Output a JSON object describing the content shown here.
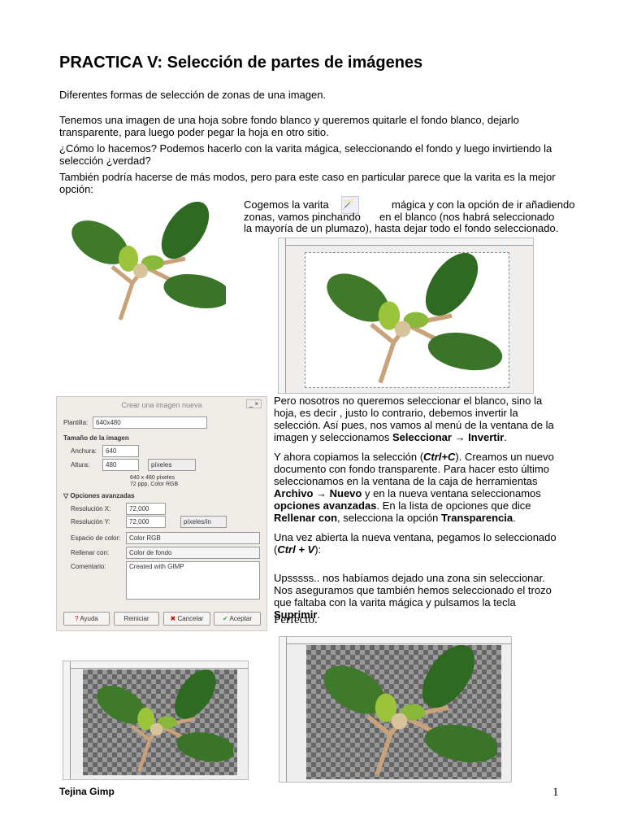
{
  "title": "PRACTICA V: Selección de partes de imágenes",
  "paragraphs": [
    "Diferentes formas de selección de zonas de una imagen.",
    "Tenemos una imagen de una hoja sobre fondo blanco y queremos quitarle el fondo blanco, dejarlo transparente, para luego poder pegar la hoja en otro sitio.",
    "¿Cómo lo hacemos? Podemos hacerlo con la varita mágica, seleccionando el fondo y luego invirtiendo la selección ¿verdad?",
    "También podría hacerse de más modos, pero para este caso en particular parece que la varita es la mejor opción:"
  ],
  "right": {
    "p1a": "Cogemos la varita",
    "p1b": "mágica y con la opción de ir añadiendo",
    "p1c": "zonas, vamos pinchando",
    "p1d": "en el blanco (nos habrá seleccionado",
    "p1e": "la mayoría de un plumazo), hasta dejar todo el fondo seleccionado.",
    "p2": "Pero nosotros no queremos seleccionar el blanco, sino la hoja, es decir , justo lo contrario, debemos invertir la selección. Así pues, nos vamos al menú de la ventana de la imagen y seleccionamos ",
    "p2b": "Seleccionar → Invertir",
    "p3a": "Y ahora copiamos la selección (",
    "p3b": "Ctrl+C",
    "p3c": "). Creamos un nuevo documento con fondo transparente. Para hacer esto último seleccionamos en la ventana de la caja de herramientas ",
    "p3d": "Archivo → Nuevo",
    "p3e": " y en la nueva ventana seleccionamos ",
    "p3f": "opciones avanzadas",
    "p3g": ". En la lista de opciones que dice ",
    "p3h": "Rellenar con",
    "p3i": ", selecciona la opción ",
    "p3j": "Transparencia",
    "p4a": "Una vez abierta la nueva ventana, pegamos lo seleccionado (",
    "p4b": "Ctrl + V",
    "p4c": "):",
    "p5a": "Upsssss.. nos habíamos dejado una zona sin seleccionar. Nos aseguramos que también hemos seleccionado el trozo que faltaba con la varita mágica y pulsamos la tecla ",
    "p5b": "Suprimir",
    "p6": "Perfecto."
  },
  "dialog": {
    "title": "Crear una imagen nueva",
    "plantilla_label": "Plantilla:",
    "plantilla_value": "640x480",
    "section_size": "Tamaño de la imagen",
    "anchura_label": "Anchura:",
    "anchura_value": "640",
    "altura_label": "Altura:",
    "altura_value": "480",
    "unit": "píxeles",
    "info1": "640 x 480 píxeles",
    "info2": "72 ppp, Color RGB",
    "section_adv": "Opciones avanzadas",
    "resx_label": "Resolución X:",
    "resx_value": "72,000",
    "resy_label": "Resolución Y:",
    "resy_value": "72,000",
    "res_unit": "píxeles/in",
    "color_label": "Espacio de color:",
    "color_value": "Color RGB",
    "fill_label": "Rellenar con:",
    "fill_value": "Color de fondo",
    "comment_label": "Comentario:",
    "comment_value": "Created with GIMP",
    "btn_help": "Ayuda",
    "btn_reset": "Reiniciar",
    "btn_cancel": "Cancelar",
    "btn_ok": "Aceptar"
  },
  "footer": {
    "left": "Tejina Gimp",
    "page": "1"
  }
}
